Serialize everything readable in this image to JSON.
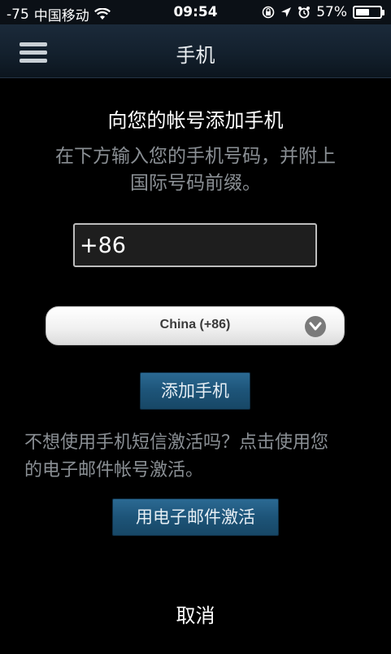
{
  "status_bar": {
    "signal": "-75",
    "carrier": "中国移动",
    "time": "09:54",
    "battery_percent": "57%",
    "battery_level": 0.57
  },
  "header": {
    "title": "手机",
    "menu_icon": "hamburger-menu-icon"
  },
  "content": {
    "heading": "向您的帐号添加手机",
    "instructions_line1": "在下方输入您的手机号码，并附上",
    "instructions_line2": "国际号码前缀。",
    "phone_value": "+86",
    "country_selected": "China (+86)",
    "add_button": "添加手机",
    "alt_line1": "不想使用手机短信激活吗？点击使用您",
    "alt_line2": "的电子邮件帐号激活。",
    "email_button": "用电子邮件激活",
    "cancel": "取消"
  },
  "colors": {
    "accent_button": "#1d5478",
    "muted_text": "#8a8f94",
    "header_bg": "#13202d"
  }
}
